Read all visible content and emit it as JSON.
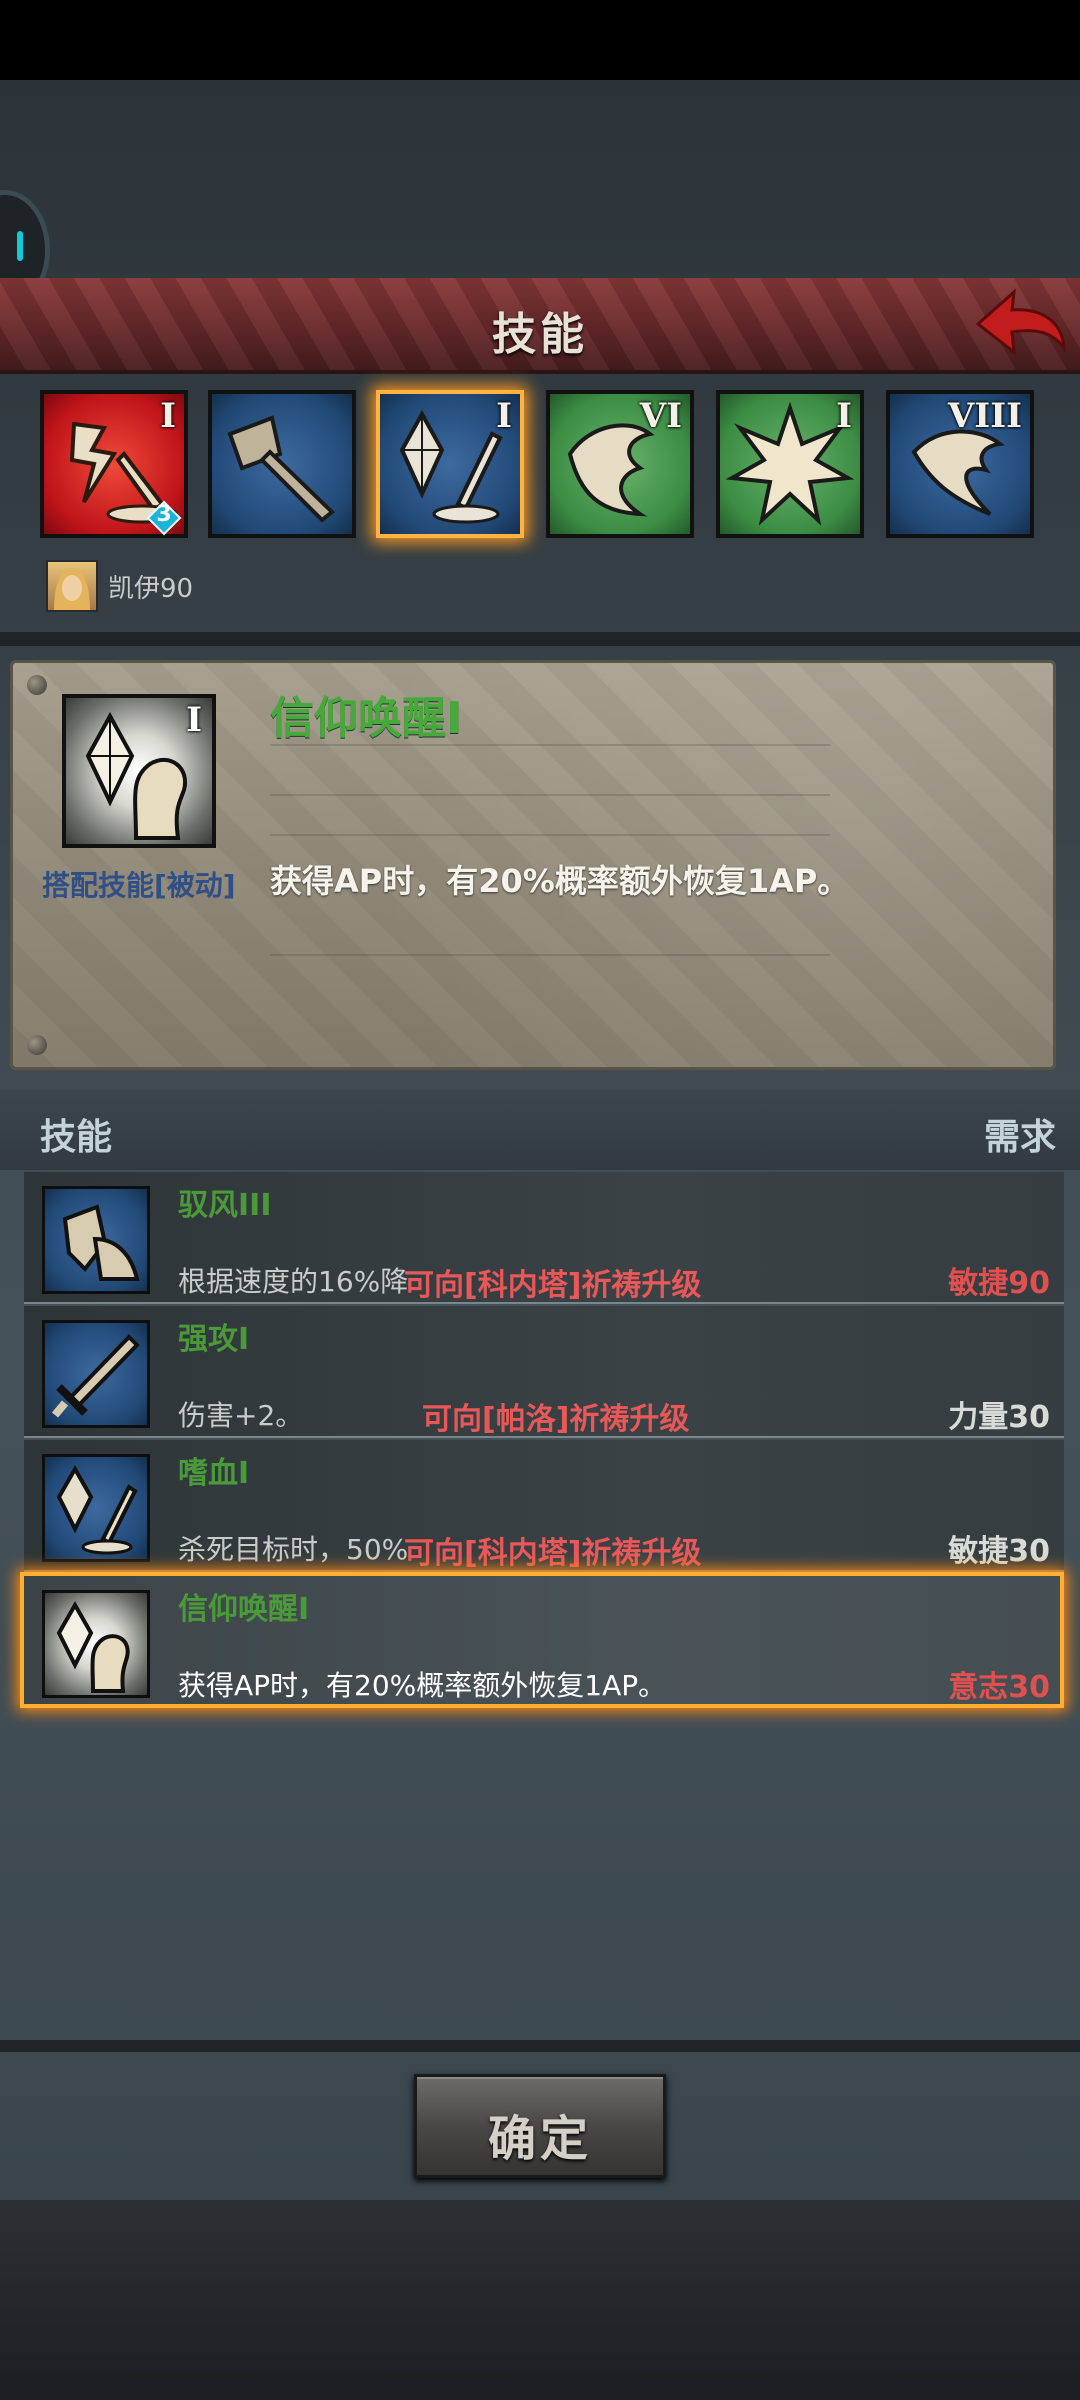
{
  "header": {
    "title": "技能"
  },
  "skill_slots": [
    {
      "numeral": "I",
      "color": "red",
      "badge": "3",
      "icon": "sword-strike-icon"
    },
    {
      "numeral": "",
      "color": "blue",
      "icon": "broken-hammer-icon"
    },
    {
      "numeral": "I",
      "color": "blue",
      "icon": "crystal-sword-icon",
      "selected": true
    },
    {
      "numeral": "VI",
      "color": "green",
      "icon": "wing-claw-icon"
    },
    {
      "numeral": "I",
      "color": "green",
      "icon": "burst-icon"
    },
    {
      "numeral": "VIII",
      "color": "blue",
      "icon": "feather-icon"
    }
  ],
  "character": {
    "name": "凯伊90"
  },
  "detail": {
    "numeral": "I",
    "name": "信仰唤醒I",
    "tag": "搭配技能[被动]",
    "description": "获得AP时，有20%概率额外恢复1AP。"
  },
  "list_header": {
    "left": "技能",
    "right": "需求"
  },
  "skills": [
    {
      "name": "驭风III",
      "desc": "根据速度的16%降",
      "hint": "可向[科内塔]祈祷升级",
      "req": "敏捷90",
      "req_color": "#e05050",
      "icon": "shield-icon"
    },
    {
      "name": "强攻I",
      "desc": "伤害+2。",
      "hint": "可向[帕洛]祈祷升级",
      "req": "力量30",
      "req_color": "#d8dcd8",
      "icon": "sword-icon"
    },
    {
      "name": "嗜血I",
      "desc": "杀死目标时，50%",
      "hint": "可向[科内塔]祈祷升级",
      "req": "敏捷30",
      "req_color": "#d8dcd8",
      "icon": "crystal-sword-icon"
    },
    {
      "name": "信仰唤醒I",
      "desc": "获得AP时，有20%概率额外恢复1AP。",
      "hint": "",
      "req": "意志30",
      "req_color": "#e05050",
      "icon": "crystal-hand-icon",
      "selected": true
    }
  ],
  "confirm_label": "确定",
  "colors": {
    "accent_orange": "#ffae30",
    "header_red": "#7a2e30",
    "skill_green": "#47a93a",
    "warn_red": "#e85858"
  }
}
